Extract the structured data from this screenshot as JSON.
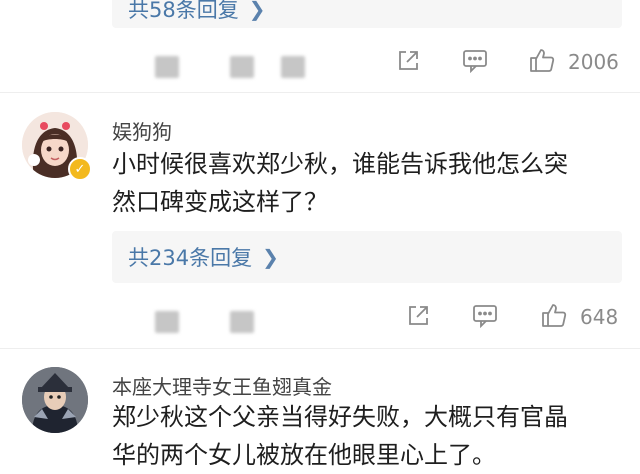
{
  "comment0": {
    "replies_label": "共58条回复",
    "likes": "2006"
  },
  "comment1": {
    "username": "娱狗狗",
    "text_line1": "小时候很喜欢郑少秋，谁能告诉我他怎么突",
    "text_line2": "然口碑变成这样了？",
    "replies_label": "共234条回复",
    "likes": "648"
  },
  "comment2": {
    "username": "本座大理寺女王鱼翅真金",
    "text_line1": "郑少秋这个父亲当得好失败，大概只有官晶",
    "text_line2": "华的两个女儿被放在他眼里心上了。"
  },
  "icons": {
    "share": "share-icon",
    "comment": "comment-icon",
    "like": "thumbs-up-icon",
    "verified": "verified-badge-icon",
    "chevron": "chevron-right-icon"
  },
  "colors": {
    "link_blue": "#4a78a8",
    "muted_gray": "#8a8a8a",
    "verified_gold": "#f3b91d"
  }
}
